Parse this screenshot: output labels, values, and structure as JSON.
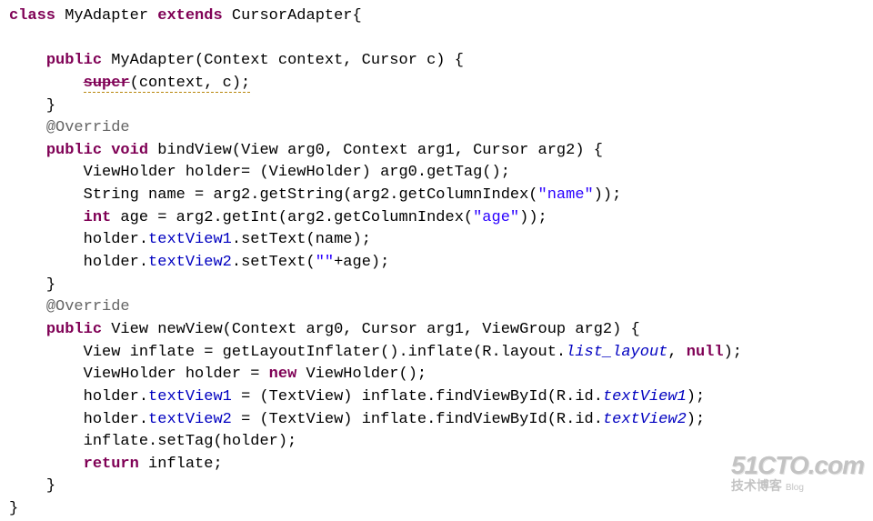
{
  "code": {
    "class_decl": {
      "kw_class": "class",
      "name": "MyAdapter",
      "kw_extends": "extends",
      "super": "CursorAdapter",
      "brace": "{"
    },
    "ctor": {
      "kw_public": "public",
      "sig": "MyAdapter(Context context, Cursor c) {",
      "super_call": {
        "kw_super": "super",
        "args": "(context, c);"
      },
      "close": "}"
    },
    "override1": "@Override",
    "bindView": {
      "kw_public": "public",
      "kw_void": "void",
      "sig": "bindView(View arg0, Context arg1, Cursor arg2) {",
      "l1": "ViewHolder holder= (ViewHolder) arg0.getTag();",
      "l2a": "String name = arg2.getString(arg2.getColumnIndex(",
      "l2s": "\"name\"",
      "l2b": "));",
      "l3kw": "int",
      "l3a": " age = arg2.getInt(arg2.getColumnIndex(",
      "l3s": "\"age\"",
      "l3b": "));",
      "l4a": "holder.",
      "l4f": "textView1",
      "l4b": ".setText(name);",
      "l5a": "holder.",
      "l5f": "textView2",
      "l5b": ".setText(",
      "l5s": "\"\"",
      "l5c": "+age);",
      "close": "}"
    },
    "override2": "@Override",
    "newView": {
      "kw_public": "public",
      "type": "View",
      "sig": "newView(Context arg0, Cursor arg1, ViewGroup arg2) {",
      "l1a": "View inflate = getLayoutInflater().inflate(R.layout.",
      "l1f": "list_layout",
      "l1b": ", ",
      "l1kw": "null",
      "l1c": ");",
      "l2a": "ViewHolder holder = ",
      "l2kw": "new",
      "l2b": " ViewHolder();",
      "l3a": "holder.",
      "l3f": "textView1",
      "l3b": " = (TextView) inflate.findViewById(R.id.",
      "l3g": "textView1",
      "l3c": ");",
      "l4a": "holder.",
      "l4f": "textView2",
      "l4b": " = (TextView) inflate.findViewById(R.id.",
      "l4g": "textView2",
      "l4c": ");",
      "l5": "inflate.setTag(holder);",
      "l6kw": "return",
      "l6": " inflate;",
      "close": "}"
    },
    "class_close": "}"
  },
  "watermark": {
    "site": "51CTO.com",
    "sub": "技术博客",
    "blog": "Blog"
  }
}
